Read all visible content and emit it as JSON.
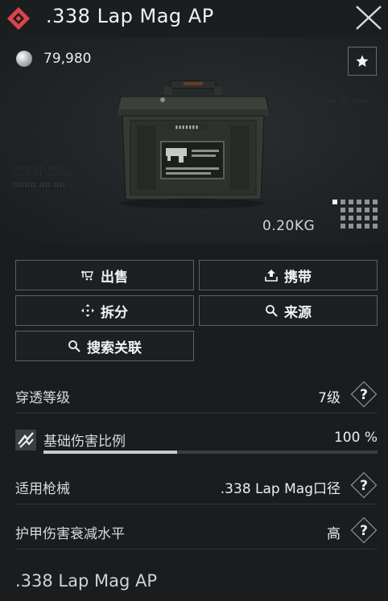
{
  "item": {
    "title": ".338 Lap Mag AP",
    "price": "79,980",
    "weight": "0.20KG"
  },
  "actions": {
    "sell": "出售",
    "carry": "携带",
    "split": "拆分",
    "source": "来源",
    "search": "搜索关联"
  },
  "stats": {
    "penetration": {
      "label": "穿透等级",
      "value": "7级"
    },
    "damage_ratio": {
      "label": "基础伤害比例",
      "value": "100 %",
      "fill_percent": 40
    },
    "weapon": {
      "label": "适用枪械",
      "value": ".338 Lap Mag口径"
    },
    "armor_decay": {
      "label": "护甲伤害衰减水平",
      "value": "高"
    }
  },
  "footer": {
    "name": ".338 Lap Mag AP"
  },
  "colors": {
    "rarity": "#e0424a",
    "background": "#1a1c1d",
    "border": "#5d6266"
  }
}
